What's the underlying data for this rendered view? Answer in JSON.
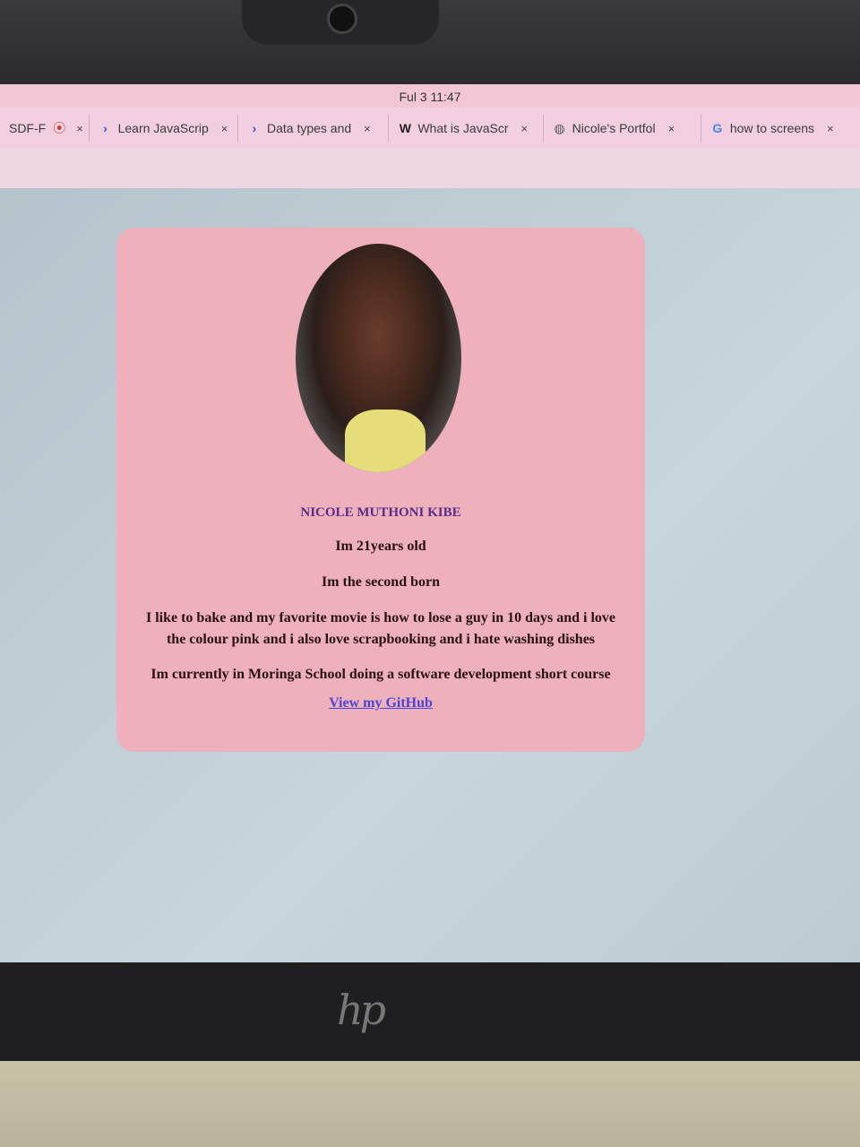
{
  "system": {
    "clock": "Ful 3  11:47"
  },
  "tabs": [
    {
      "label": "SDF-F",
      "icon": "record-icon",
      "close": "×"
    },
    {
      "label": "Learn JavaScrip",
      "icon": "codecademy-icon",
      "close": "×"
    },
    {
      "label": "Data types and",
      "icon": "codecademy-icon",
      "close": "×"
    },
    {
      "label": "What is JavaScr",
      "icon": "w-icon",
      "close": "×"
    },
    {
      "label": "Nicole's Portfol",
      "icon": "globe-icon",
      "close": "×"
    },
    {
      "label": "how to screens",
      "icon": "google-icon",
      "close": "×"
    }
  ],
  "profile": {
    "name": "NICOLE MUTHONI KIBE",
    "age": "Im 21years old",
    "birth_order": "Im the second born",
    "likes": "I like to bake and my favorite movie is how to lose a guy in 10 days and i love the colour pink and i also love scrapbooking and i hate washing dishes",
    "school": "Im currently in Moringa School doing a software development short course",
    "github_link": "View my GitHub"
  },
  "device": {
    "brand_logo": "hp"
  },
  "colors": {
    "card": "#eeb0bb",
    "name": "#5a2a8a",
    "link": "#4a44d8",
    "tabbar": "#f2cfe0"
  }
}
